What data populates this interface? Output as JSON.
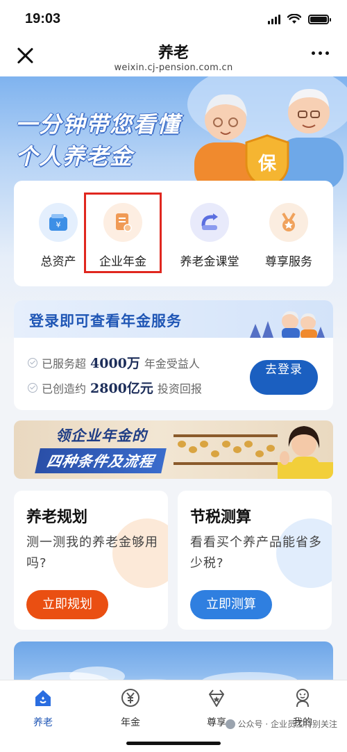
{
  "status_bar": {
    "time": "19:03"
  },
  "nav": {
    "title": "养老",
    "subtitle": "weixin.cj-pension.com.cn"
  },
  "banner": {
    "line1": "一分钟带您看懂",
    "line2": "个人养老金",
    "badge": "保"
  },
  "quick_actions": [
    {
      "label": "总资产",
      "icon": "wallet-icon",
      "color": "#3d8fe6"
    },
    {
      "label": "企业年金",
      "icon": "document-icon",
      "color": "#f09a55",
      "highlighted": true
    },
    {
      "label": "养老金课堂",
      "icon": "arrow-loop-icon",
      "color": "#5b6fe0"
    },
    {
      "label": "尊享服务",
      "icon": "medal-icon",
      "color": "#f0a25c"
    }
  ],
  "login_card": {
    "title": "登录即可查看年金服务",
    "line1_pre": "已服务超",
    "line1_num": "4000万",
    "line1_post": "年金受益人",
    "line2_pre": "已创造约",
    "line2_num": "2800亿元",
    "line2_post": "投资回报",
    "button": "去登录"
  },
  "promo": {
    "line1": "领企业年金的",
    "line2": "四种条件及流程"
  },
  "features": [
    {
      "title": "养老规划",
      "desc": "测一测我的养老金够用吗?",
      "button": "立即规划",
      "color": "#ea4f12"
    },
    {
      "title": "节税测算",
      "desc": "看看买个养产品能省多少税?",
      "button": "立即测算",
      "color": "#2f7fe0"
    }
  ],
  "tabs": [
    {
      "label": "养老",
      "icon": "home-icon",
      "active": true
    },
    {
      "label": "年金",
      "icon": "yen-icon"
    },
    {
      "label": "尊享",
      "icon": "crown-icon"
    },
    {
      "label": "我的",
      "icon": "user-icon"
    }
  ],
  "watermark": "公众号 · 企业员工特别关注",
  "accent": "#1f56b5"
}
